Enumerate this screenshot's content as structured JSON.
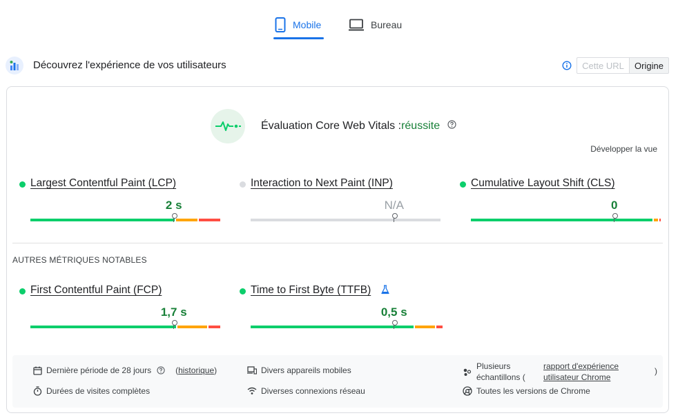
{
  "tabs": [
    {
      "label": "Mobile",
      "icon": "smartphone-icon",
      "active": true
    },
    {
      "label": "Bureau",
      "icon": "laptop-icon",
      "active": false
    }
  ],
  "header": {
    "title": "Découvrez l'expérience de vos utilisateurs",
    "toggle": {
      "url_label": "Cette URL",
      "origin_label": "Origine",
      "selected": "Origine"
    }
  },
  "cwv": {
    "label": "Évaluation Core Web Vitals :",
    "result": "réussite",
    "expand_label": "Développer la vue"
  },
  "core_metrics": [
    {
      "name": "Largest Contentful Paint (LCP)",
      "value": "2 s",
      "status": "good",
      "marker_fraction": 0.75,
      "dist": [
        0.76,
        0.12,
        0.12
      ]
    },
    {
      "name": "Interaction to Next Paint (INP)",
      "value": "N/A",
      "status": "none",
      "marker_fraction": 0.75,
      "dist": [
        1,
        0,
        0
      ]
    },
    {
      "name": "Cumulative Layout Shift (CLS)",
      "value": "0",
      "status": "good",
      "marker_fraction": 0.75,
      "dist": [
        0.955,
        0.03,
        0.015
      ]
    }
  ],
  "other_section_label": "AUTRES MÉTRIQUES NOTABLES",
  "other_metrics": [
    {
      "name": "First Contentful Paint (FCP)",
      "value": "1,7 s",
      "status": "good",
      "marker_fraction": 0.75,
      "dist": [
        0.77,
        0.16,
        0.07
      ]
    },
    {
      "name": "Time to First Byte (TTFB)",
      "value": "0,5 s",
      "status": "good",
      "marker_fraction": 0.75,
      "experimental": true,
      "dist": [
        0.86,
        0.11,
        0.04
      ]
    }
  ],
  "footer": {
    "period": "Dernière période de 28 jours",
    "history_link": "historique",
    "devices": "Divers appareils mobiles",
    "samples_prefix": "Plusieurs échantillons (",
    "report_link": "rapport d'expérience utilisateur Chrome",
    "samples_suffix": ")",
    "durations": "Durées de visites complètes",
    "network": "Diverses connexions réseau",
    "chrome": "Toutes les versions de Chrome"
  },
  "colors": {
    "accent": "#1a73e8",
    "good": "#0cce6b",
    "good_text": "#188038",
    "needs_improvement": "#ffa400",
    "poor": "#ff4e42",
    "na": "#dadce0"
  }
}
